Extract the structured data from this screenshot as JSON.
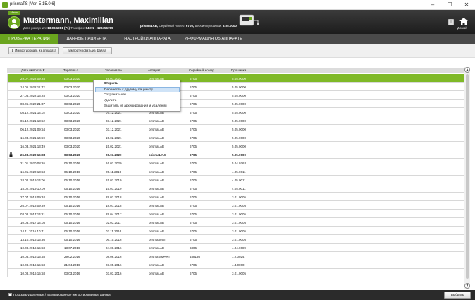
{
  "window": {
    "title": "prismaTS [Ver. 5.15.0.6]",
    "minimize": "–",
    "maximize": "☐",
    "close": "✕"
  },
  "header": {
    "menu_label": "Меню",
    "patient_name": "Mustermann, Maximilian",
    "patient_info_label": "Дата рождения:",
    "patient_dob": "13.08.1981 (71)",
    "phone_label": "Телефон:",
    "phone": "04072 - 123456789",
    "device_name": "prismaLAB,",
    "serial_label": "Серийный номер:",
    "serial": "6705,",
    "fw_label": "Версия прошивки:",
    "fw": "5.05.0000",
    "home_label": "Домой"
  },
  "tabs": [
    {
      "label": "ПРОВЕРКА ТЕРАПИИ"
    },
    {
      "label": "ДАННЫЕ ПАЦИЕНТА"
    },
    {
      "label": "НАСТРОЙКИ АППАРАТА"
    },
    {
      "label": "ИНФОРМАЦИЯ ОБ АППАРАТЕ"
    }
  ],
  "toolbar": {
    "import_device": "Импортировать из аппарата",
    "import_file": "Импортировать из файла"
  },
  "table": {
    "headers": [
      "Дата импорта ▼",
      "Терапия с",
      "Терапия по",
      "Аппарат",
      "Серийный номер",
      "Прошивка"
    ],
    "rows": [
      [
        "29.07.2022 09:28",
        "03.03.2020",
        "28.07.2022",
        "prismaLAB",
        "6705",
        "5.05.0000"
      ],
      [
        "14.06.2022 11:42",
        "03.03.2020",
        "13.06.2022",
        "prismaLAB",
        "6705",
        "5.05.0000"
      ],
      [
        "27.06.2022 13:28",
        "03.03.2020",
        "26.06.2022",
        "prismaLAB",
        "6705",
        "5.05.0000"
      ],
      [
        "08.06.2022 21:37",
        "03.03.2020",
        "07.06.2022",
        "prismaLAB",
        "6705",
        "5.05.0000"
      ],
      [
        "08.12.2021 14:02",
        "03.03.2020",
        "07.12.2021",
        "prismaLAB",
        "6705",
        "5.05.0000"
      ],
      [
        "06.12.2021 13:52",
        "03.03.2020",
        "03.12.2021",
        "prismaLAB",
        "6705",
        "5.05.0000"
      ],
      [
        "06.12.2021 09:54",
        "03.03.2020",
        "03.12.2021",
        "prismaLAB",
        "6705",
        "5.05.0000"
      ],
      [
        "16.03.2021 14:59",
        "03.03.2020",
        "15.02.2021",
        "prismaLAB",
        "6705",
        "5.05.0000"
      ],
      [
        "16.03.2021 13:49",
        "03.03.2020",
        "15.02.2021",
        "prismaLAB",
        "6705",
        "5.05.0000"
      ],
      [
        "26.03.2020 15:33",
        "03.03.2020",
        "26.03.2020",
        "prismaLAB",
        "6705",
        "5.05.0000"
      ],
      [
        "21.01.2020 08:26",
        "06.10.2016",
        "16.01.2020",
        "prismaLAB",
        "6705",
        "5.04.0263"
      ],
      [
        "16.01.2020 13:53",
        "06.10.2016",
        "25.11.2019",
        "prismaLAB",
        "6705",
        "4.05.0011"
      ],
      [
        "18.02.2019 14:06",
        "06.10.2016",
        "15.01.2019",
        "prismaLAB",
        "6705",
        "4.05.0011"
      ],
      [
        "15.02.2019 10:09",
        "06.10.2016",
        "15.01.2019",
        "prismaLAB",
        "6705",
        "4.05.0011"
      ],
      [
        "27.07.2018 09:34",
        "06.10.2016",
        "29.07.2018",
        "prismaLAB",
        "6705",
        "3.01.0005"
      ],
      [
        "26.07.2018 09:39",
        "06.10.2016",
        "18.07.2018",
        "prismaLAB",
        "6705",
        "3.01.0005"
      ],
      [
        "03.08.2017 14:21",
        "06.10.2016",
        "29.04.2017",
        "prismaLAB",
        "6705",
        "3.01.0005"
      ],
      [
        "10.03.2017 14:08",
        "06.10.2016",
        "02.03.2017",
        "prismaLAB",
        "6705",
        "3.01.0005"
      ],
      [
        "14.11.2016 10:41",
        "06.10.2016",
        "03.11.2016",
        "prismaLAB",
        "6705",
        "3.01.0005"
      ],
      [
        "13.10.2016 15:36",
        "06.10.2016",
        "06.10.2016",
        "prisma30ST",
        "6705",
        "3.01.0005"
      ],
      [
        "10.08.2016 15:58",
        "13.07.2016",
        "04.08.2016",
        "prismaLAB",
        "6806",
        "4.04.0689"
      ],
      [
        "10.08.2016 15:58",
        "29.02.2016",
        "08.06.2016",
        "prisma SMART",
        "488136",
        "1.2.0024"
      ],
      [
        "10.08.2016 15:58",
        "21.04.2016",
        "23.05.2016",
        "prismaLAB",
        "6705",
        "4.4.0000"
      ],
      [
        "10.08.2016 15:58",
        "03.03.2016",
        "03.03.2016",
        "prismaLAB",
        "6705",
        "3.01.0005"
      ]
    ]
  },
  "context_menu": {
    "items": [
      "Открыть",
      "Перенести к другому пациенту...",
      "Сохранить как...",
      "Удалить",
      "Защитить от архивирования и удаления"
    ]
  },
  "footer": {
    "show_deleted": "Показать удаленные / архивированные импортированные данные",
    "select": "Выбрать"
  },
  "scrollbar": {
    "up": "▲",
    "down": "▼"
  },
  "colors": {
    "accent": "#6aa51e",
    "selected_row": "#7fb927",
    "header_bg": "#2b2b2b"
  }
}
